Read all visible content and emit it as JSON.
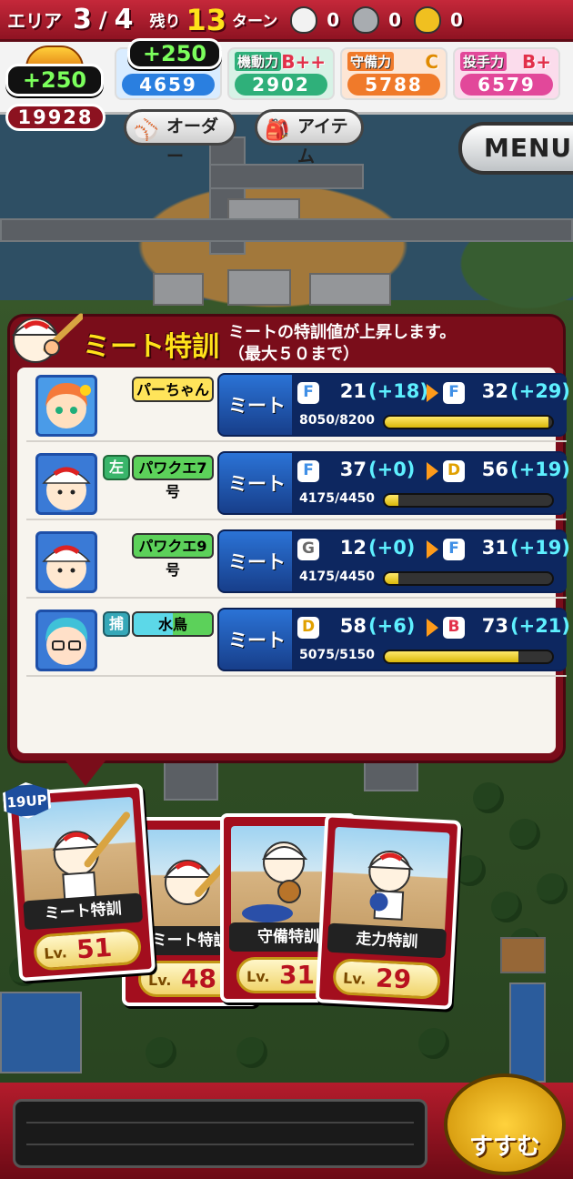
{
  "topbar": {
    "area_label": "エリア",
    "area_current": "3",
    "area_sep": "/",
    "area_total": "4",
    "remain_label": "残り",
    "turns_left": "13",
    "turn_label": "ターン",
    "bags": [
      {
        "icon": "white-bag-icon",
        "count": "0",
        "color": "#f2f2f2"
      },
      {
        "icon": "silver-bag-icon",
        "count": "0",
        "color": "#a8acb0"
      },
      {
        "icon": "gold-bag-icon",
        "count": "0",
        "color": "#f0c020"
      }
    ]
  },
  "total": {
    "gain": "+250",
    "value": "19928"
  },
  "stats": [
    {
      "title": "",
      "grade": "",
      "value": "4659",
      "gain": "+250",
      "color": "#2a7fe0"
    },
    {
      "title": "機動力",
      "grade": "B++",
      "value": "2902",
      "color": "#2fb07a"
    },
    {
      "title": "守備力",
      "grade": "C",
      "value": "5788",
      "color": "#f07a2a"
    },
    {
      "title": "投手力",
      "grade": "B+",
      "value": "6579",
      "color": "#e2489a"
    }
  ],
  "subtabs": {
    "order": "オーダー",
    "item": "アイテム"
  },
  "menu_label": "MENU",
  "panel": {
    "title": "ミート特訓",
    "desc_line1": "ミートの特訓値が上昇します。",
    "desc_line2": "（最大５０まで）",
    "rows": [
      {
        "name": "パーちゃん",
        "pos": "",
        "stat": "ミート",
        "from_grade": "F",
        "from_val": "21",
        "from_plus": "(+18)",
        "to_grade": "F",
        "to_val": "32",
        "to_plus": "(+29)",
        "exp": "8050/8200",
        "fill": 0.98
      },
      {
        "name": "パワクエ7号",
        "pos": "左",
        "stat": "ミート",
        "from_grade": "F",
        "from_val": "37",
        "from_plus": "(+0)",
        "to_grade": "D",
        "to_val": "56",
        "to_plus": "(+19)",
        "exp": "4175/4450",
        "fill": 0.08
      },
      {
        "name": "パワクエ9号",
        "pos": "",
        "stat": "ミート",
        "from_grade": "G",
        "from_val": "12",
        "from_plus": "(+0)",
        "to_grade": "F",
        "to_val": "31",
        "to_plus": "(+19)",
        "exp": "4175/4450",
        "fill": 0.08
      },
      {
        "name": "水鳥",
        "pos": "捕",
        "stat": "ミート",
        "from_grade": "D",
        "from_val": "58",
        "from_plus": "(+6)",
        "to_grade": "B",
        "to_val": "73",
        "to_plus": "(+21)",
        "exp": "5075/5150",
        "fill": 0.8
      }
    ]
  },
  "cards": [
    {
      "name": "ミート特訓",
      "lv_label": "Lv.",
      "lv": "51",
      "badge": "19UP"
    },
    {
      "name": "ミート特訓",
      "lv_label": "Lv.",
      "lv": "48"
    },
    {
      "name": "守備特訓",
      "lv_label": "Lv.",
      "lv": "31"
    },
    {
      "name": "走力特訓",
      "lv_label": "Lv.",
      "lv": "29"
    }
  ],
  "susumu_label": "すすむ",
  "grade_colors": {
    "G": "#6b6b6b",
    "F": "#3f8fe6",
    "D": "#e0a000",
    "B": "#e2304a"
  }
}
